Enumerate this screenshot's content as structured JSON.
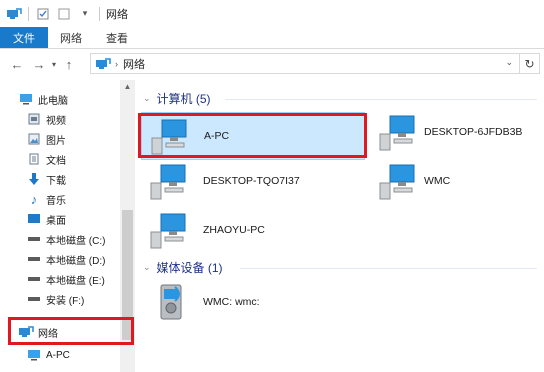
{
  "window": {
    "title": "网络"
  },
  "ribbon": {
    "tabs": [
      "文件",
      "网络",
      "查看"
    ]
  },
  "address": {
    "path": "网络"
  },
  "nav": {
    "items": [
      {
        "label": "此电脑",
        "icon": "pc-icon"
      },
      {
        "label": "视频",
        "icon": "video-icon"
      },
      {
        "label": "图片",
        "icon": "picture-icon"
      },
      {
        "label": "文档",
        "icon": "document-icon"
      },
      {
        "label": "下载",
        "icon": "download-icon"
      },
      {
        "label": "音乐",
        "icon": "music-icon"
      },
      {
        "label": "桌面",
        "icon": "desktop-icon"
      },
      {
        "label": "本地磁盘 (C:)",
        "icon": "drive-icon"
      },
      {
        "label": "本地磁盘 (D:)",
        "icon": "drive-icon"
      },
      {
        "label": "本地磁盘 (E:)",
        "icon": "drive-icon"
      },
      {
        "label": "安装 (F:)",
        "icon": "drive-icon"
      },
      {
        "label": "网络",
        "icon": "network-icon"
      },
      {
        "label": "A-PC",
        "icon": "computer-icon"
      }
    ]
  },
  "groups": {
    "computers": {
      "header": "计算机 (5)",
      "items": [
        "A-PC",
        "DESKTOP-6JFDB3B",
        "DESKTOP-TQO7I37",
        "WMC",
        "ZHAOYU-PC"
      ]
    },
    "media": {
      "header": "媒体设备 (1)",
      "items": [
        "WMC: wmc:"
      ]
    }
  },
  "colors": {
    "accent": "#1979ca",
    "highlight": "#e0191e",
    "selection": "#cce8ff",
    "group_header": "#1e3287"
  }
}
